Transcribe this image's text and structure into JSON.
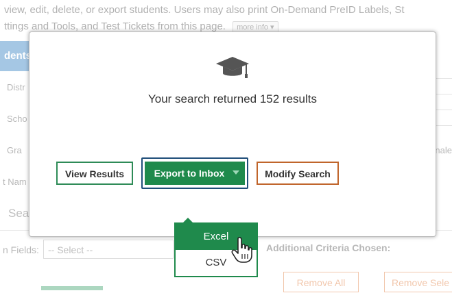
{
  "background": {
    "intro_line1": "view, edit, delete, or export students. Users may also print On-Demand PreID Labels, St",
    "intro_line2": "ttings and Tools, and Test Tickets from this page.",
    "more_info": "more info",
    "panel_title": "dents",
    "labels": [
      "Distr",
      "Scho",
      "Gra",
      "t Nam"
    ],
    "right_text": "nale",
    "search_heading": "Sea",
    "fields_label": "n Fields:",
    "select_placeholder": "-- Select --",
    "additional_criteria": "Additional Criteria Chosen:",
    "remove_all": "Remove All",
    "remove_selected": "Remove Sele"
  },
  "modal": {
    "icon": "graduation-cap-icon",
    "message": "Your search returned 152 results",
    "buttons": {
      "view_results": "View Results",
      "export_to_inbox": "Export to Inbox",
      "modify_search": "Modify Search"
    }
  },
  "export_menu": {
    "items": [
      {
        "label": "Excel",
        "selected": true
      },
      {
        "label": "CSV",
        "selected": false
      }
    ]
  },
  "colors": {
    "green": "#1f8a4c",
    "navy_focus": "#1f4e79",
    "orange": "#c0652b",
    "blue_header": "#2b7bbf"
  }
}
